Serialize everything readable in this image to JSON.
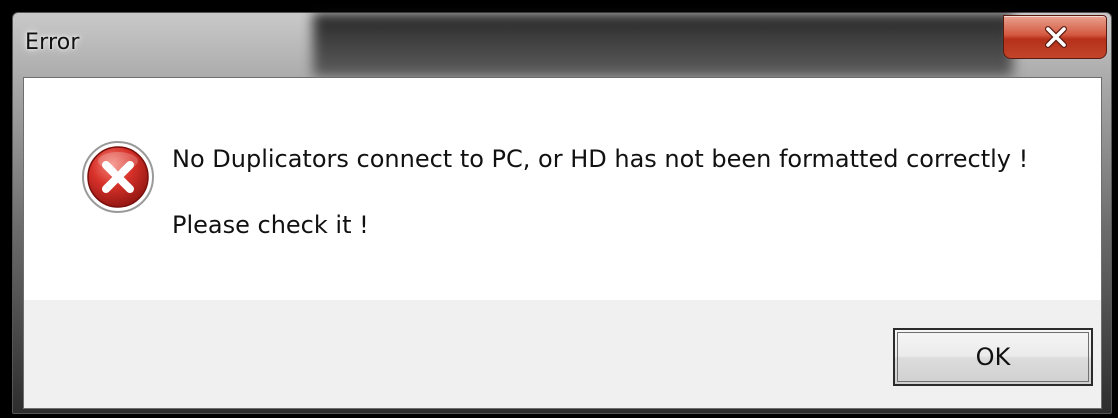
{
  "window": {
    "title": "Error",
    "close_icon": "close-icon"
  },
  "message": {
    "icon": "error-icon",
    "line1": "No Duplicators connect to PC, or HD has not been formatted correctly !",
    "line2": "Please check it !"
  },
  "buttons": {
    "ok_label": "OK"
  },
  "colors": {
    "error_red": "#d8322a",
    "close_button": "#c2452a",
    "footer_bg": "#f0f0f0"
  }
}
